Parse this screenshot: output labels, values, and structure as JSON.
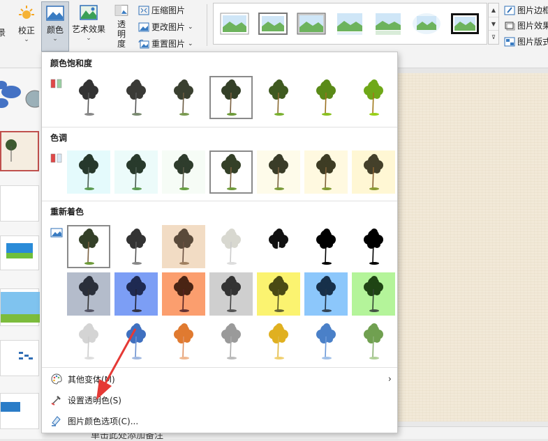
{
  "ribbon": {
    "left_edge_label": "景",
    "correct_label": "校正",
    "color_label": "颜色",
    "artistic_label": "艺术效果",
    "transparency_label": "透明度",
    "compress_label": "压缩图片",
    "change_label": "更改图片",
    "reset_label": "重置图片",
    "border_label": "图片边框",
    "effect_label": "图片效果",
    "layout_label": "图片版式"
  },
  "colors": {
    "accent": "#c0504d",
    "menu_bg": "#ffffff",
    "selected_ribbon": "#cfd6de",
    "canvas": "#f2e9d8"
  },
  "menu": {
    "saturation_title": "颜色饱和度",
    "tone_title": "色调",
    "recolor_title": "重新着色",
    "saturation_tiles": [
      "sat-0",
      "sat-33",
      "sat-66",
      "sat-100",
      "sat-200",
      "sat-300",
      "sat-400"
    ],
    "saturation_selected": 3,
    "tone_tiles": [
      "tone-4700K",
      "tone-5300K",
      "tone-5900K",
      "tone-6500K",
      "tone-7200K",
      "tone-8800K",
      "tone-11200K"
    ],
    "tone_selected": 3,
    "recolor_selected": 0,
    "more_variants": "其他变体(M)",
    "set_transparent": "设置透明色(S)",
    "picture_color_options": "图片颜色选项(C)..."
  },
  "notes_placeholder": "单击此处添加备注"
}
